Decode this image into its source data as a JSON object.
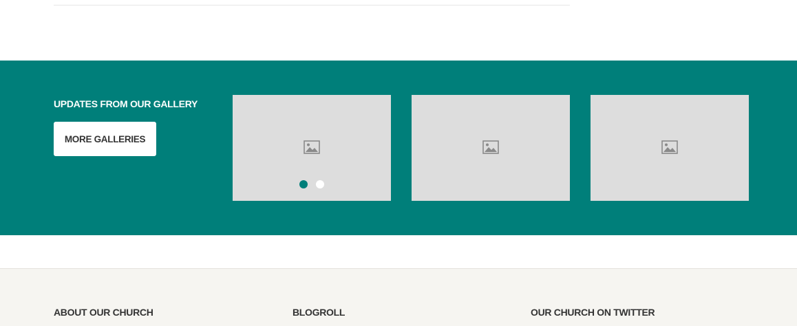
{
  "gallery": {
    "title": "UPDATES FROM OUR GALLERY",
    "button_label": "MORE GALLERIES",
    "thumbnails": [
      {
        "icon": "image-placeholder-icon"
      },
      {
        "icon": "image-placeholder-icon"
      },
      {
        "icon": "image-placeholder-icon"
      }
    ],
    "carousel": {
      "total_pages": 2,
      "active_page": 1
    },
    "colors": {
      "band": "#007f7a",
      "thumbnail_bg": "#dddddd",
      "dot_active": "#007f7a",
      "dot_inactive": "#ffffff"
    }
  },
  "footer": {
    "headings": [
      "ABOUT OUR CHURCH",
      "BLOGROLL",
      "OUR CHURCH ON TWITTER"
    ],
    "colors": {
      "background": "#f6f5f1"
    }
  }
}
